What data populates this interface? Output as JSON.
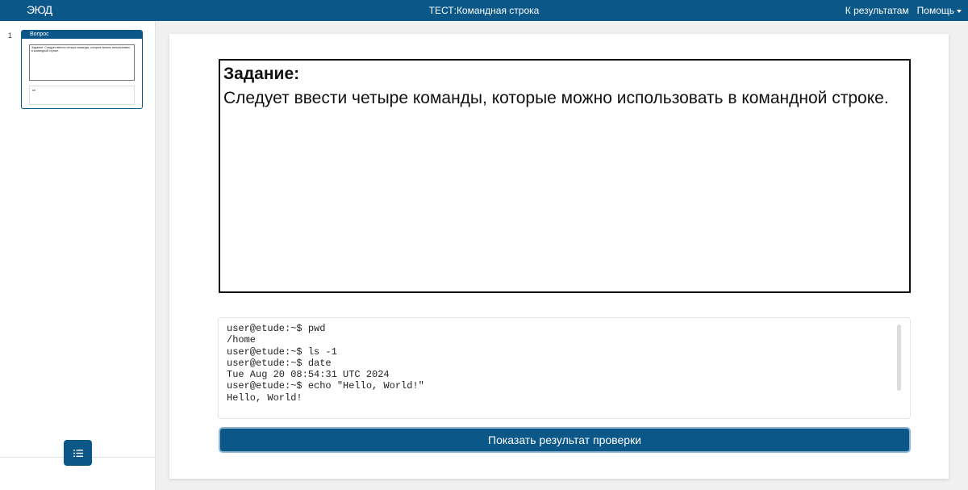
{
  "header": {
    "logo": "ЭЮД",
    "title": "ТЕСТ:Командная строка",
    "results_link": "К результатам",
    "help_menu": "Помощь"
  },
  "sidebar": {
    "slides": [
      {
        "number": "1",
        "title": "Вопрос",
        "preview_text": "Задание:\nСледует ввести четыре команды, которые можно использовать в командной строке.",
        "preview_terminal": "ke"
      }
    ],
    "list_button_icon": "list-icon"
  },
  "task": {
    "heading": "Задание:",
    "text": "Следует ввести четыре команды, которые можно использовать в командной строке."
  },
  "terminal": {
    "lines": [
      "user@etude:~$ pwd",
      "/home",
      "user@etude:~$ ls -1",
      "user@etude:~$ date",
      "Tue Aug 20 08:54:31 UTC 2024",
      "user@etude:~$ echo \"Hello, World!\"",
      "Hello, World!"
    ]
  },
  "check_button": "Показать результат проверки",
  "colors": {
    "primary": "#0b5788",
    "background": "#f0f0f0"
  }
}
